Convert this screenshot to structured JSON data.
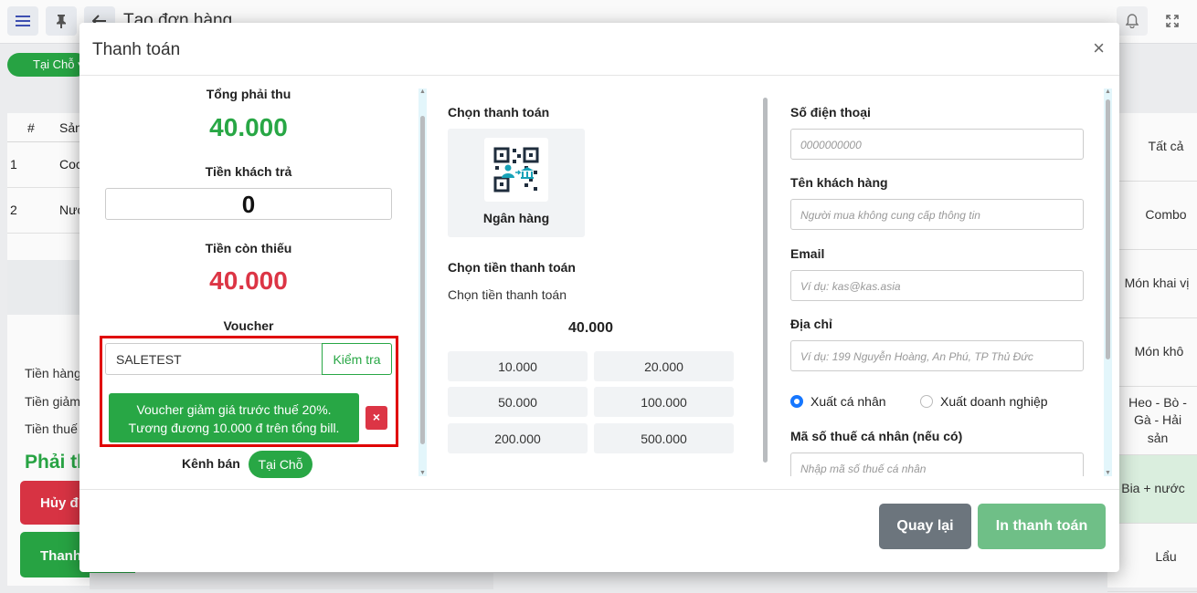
{
  "app": {
    "page_title": "Tạo đơn hàng",
    "channel_pill": "Tại Chỗ ▾",
    "table_header": [
      "#",
      "Sản"
    ],
    "rows": [
      {
        "no": "1",
        "name": "Coc"
      },
      {
        "no": "2",
        "name": "Nướ"
      }
    ],
    "summary": [
      "Tiền hàng",
      "Tiền giảm",
      "Tiền thuế"
    ],
    "pay_total_label": "Phải th",
    "cancel_btn": "Hủy đ",
    "pay_btn": "Thanh",
    "categories": [
      "Tất cả",
      "Combo",
      "Món khai vị",
      "Món khô",
      "Heo - Bò - Gà - Hải sản",
      "Bia + nước",
      "Lẩu"
    ]
  },
  "modal": {
    "title": "Thanh toán",
    "close": "×",
    "total_due_label": "Tổng phải thu",
    "total_due": "40.000",
    "paid_label": "Tiền khách trả",
    "paid_value": "0",
    "remaining_label": "Tiền còn thiếu",
    "remaining": "40.000",
    "voucher_label": "Voucher",
    "voucher_code": "SALETEST",
    "check_btn": "Kiểm tra",
    "voucher_note_1": "Voucher giảm giá trước thuế 20%.",
    "voucher_note_2": "Tương đương 10.000 đ trên tổng bill.",
    "voucher_remove": "×",
    "channel_label": "Kênh bán",
    "channel_value": "Tại Chỗ",
    "payment_method_label": "Chọn thanh toán",
    "bank_label": "Ngân hàng",
    "payment_amount_label": "Chọn tiền thanh toán",
    "payment_amount_hint": "Chọn tiền thanh toán",
    "payment_amount": "40.000",
    "amounts": [
      "10.000",
      "20.000",
      "50.000",
      "100.000",
      "200.000",
      "500.000"
    ],
    "phone_label": "Số điện thoại",
    "phone_placeholder": "0000000000",
    "name_label": "Tên khách hàng",
    "name_placeholder": "Người mua không cung cấp thông tin",
    "email_label": "Email",
    "email_placeholder": "Ví dụ: kas@kas.asia",
    "address_label": "Địa chỉ",
    "address_placeholder": "Ví dụ: 199 Nguyễn Hoàng, An Phú, TP Thủ Đức",
    "invoice_personal": "Xuất cá nhân",
    "invoice_business": "Xuất doanh nghiệp",
    "tax_label": "Mã số thuế cá nhân (nếu có)",
    "tax_placeholder": "Nhập mã số thuế cá nhân",
    "back_btn": "Quay lại",
    "print_btn": "In thanh toán"
  },
  "colors": {
    "success": "#28a745",
    "danger": "#dc3545",
    "secondary": "#6c757d",
    "highlight_frame": "#e00000",
    "radio_on": "#1677ff"
  }
}
